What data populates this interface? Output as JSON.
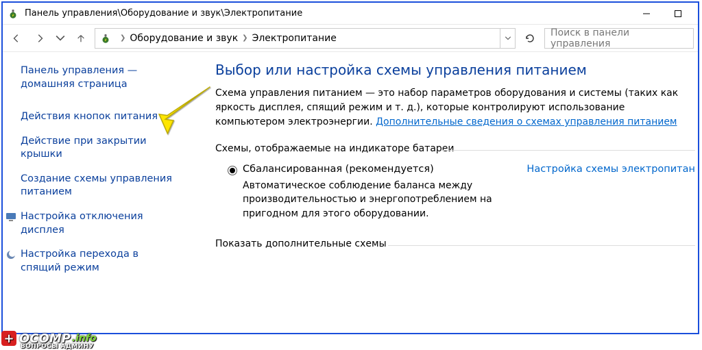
{
  "titlebar": {
    "title": "Панель управления\\Оборудование и звук\\Электропитание"
  },
  "breadcrumb": {
    "items": [
      "Оборудование и звук",
      "Электропитание"
    ]
  },
  "search": {
    "placeholder": "Поиск в панели управления"
  },
  "sidebar": {
    "home1": "Панель управления —",
    "home2": "домашняя страница",
    "link_buttons": "Действия кнопок питания",
    "link_lid1": "Действие при закрытии",
    "link_lid2": "крышки",
    "link_create1": "Создание схемы управления",
    "link_create2": "питанием",
    "link_display1": "Настройка отключения",
    "link_display2": "дисплея",
    "link_sleep1": "Настройка перехода в",
    "link_sleep2": "спящий режим"
  },
  "main": {
    "heading": "Выбор или настройка схемы управления питанием",
    "desc1": "Схема управления питанием — это набор параметров оборудования и системы (таких как яркость дисплея, спящий режим и т. д.), которые контролируют использование компьютером электроэнергии. ",
    "desc_link": "Дополнительные сведения о схемах управления питанием",
    "group_title": "Схемы, отображаемые на индикаторе батареи",
    "plan_name": "Сбалансированная (рекомендуется)",
    "plan_desc": "Автоматическое соблюдение баланса между производительностью и энергопотреблением на пригодном для этого оборудовании.",
    "plan_settings": "Настройка схемы электропитан",
    "show_more": "Показать дополнительные схемы"
  },
  "watermark": {
    "brand": "OCOMP",
    "tld": ".info",
    "sub": "ВОПРОСЫ АДМИНУ"
  }
}
